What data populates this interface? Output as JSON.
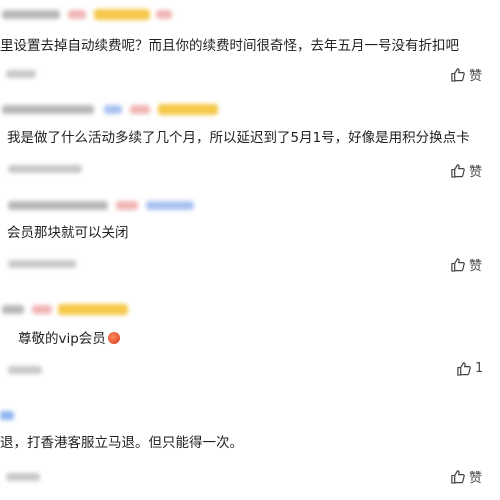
{
  "comments": [
    {
      "text": "里设置去掉自动续费呢？而且你的续费时间很奇怪，去年五月一号没有折扣吧",
      "like_label": "赞"
    },
    {
      "text": "我是做了什么活动多续了几个月，所以延迟到了5月1号，好像是用积分换点卡",
      "like_label": "赞"
    },
    {
      "text": "会员那块就可以关闭",
      "like_label": "赞"
    },
    {
      "text": "尊敬的vip会员",
      "like_count": "1"
    },
    {
      "text": "退，打香港客服立马退。但只能得一次。",
      "like_label": "赞"
    }
  ],
  "icons": {
    "like": "thumbs-up-icon",
    "emoji": "peach-emoji-icon"
  },
  "colors": {
    "blur_text": "#9a9a9a",
    "blur_badge_yellow": "#f5c84a",
    "blur_badge_red": "#e86a6a",
    "blur_badge_blue": "#6a9cf5"
  }
}
